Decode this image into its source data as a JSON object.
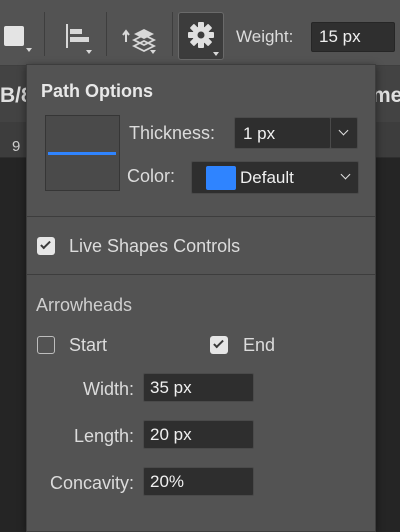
{
  "toolbar": {
    "weight_label": "Weight:",
    "weight_value": "15 px",
    "icons": [
      "fill-swatch",
      "align-left-icon",
      "arrange-icon",
      "gear-icon"
    ]
  },
  "background": {
    "tab_left_text": "B/8",
    "tab_right_text": "me",
    "ruler_number": "9"
  },
  "path_options": {
    "title": "Path Options",
    "thickness_label": "Thickness:",
    "thickness_value": "1 px",
    "color_label": "Color:",
    "color_value": "Default",
    "color_swatch": "#2f84ff",
    "live_shapes_label": "Live Shapes Controls",
    "live_shapes_checked": true
  },
  "arrowheads": {
    "heading": "Arrowheads",
    "start_label": "Start",
    "start_checked": false,
    "end_label": "End",
    "end_checked": true,
    "width_label": "Width:",
    "width_value": "35 px",
    "length_label": "Length:",
    "length_value": "20 px",
    "concavity_label": "Concavity:",
    "concavity_value": "20%"
  },
  "colors": {
    "panel_bg": "#535353",
    "field_bg": "#2e2e2e",
    "accent": "#2f84ff",
    "canvas": "#252525"
  }
}
